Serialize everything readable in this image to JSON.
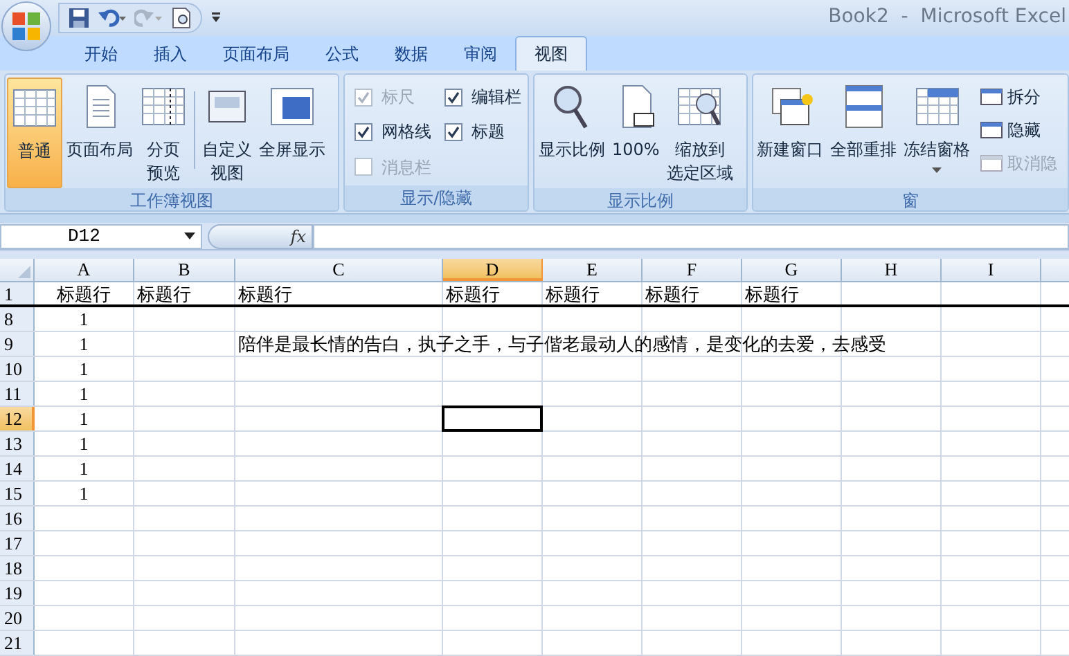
{
  "window": {
    "title": "Book2  -  Microsoft Excel"
  },
  "tabs": [
    {
      "label": "开始",
      "selected": false
    },
    {
      "label": "插入",
      "selected": false
    },
    {
      "label": "页面布局",
      "selected": false
    },
    {
      "label": "公式",
      "selected": false
    },
    {
      "label": "数据",
      "selected": false
    },
    {
      "label": "审阅",
      "selected": false
    },
    {
      "label": "视图",
      "selected": true
    }
  ],
  "ribbon": [
    {
      "label": "工作簿视图",
      "items": [
        {
          "kind": "large",
          "label": "普通",
          "selected": true
        },
        {
          "kind": "large",
          "label": "页面布局",
          "selected": false
        },
        {
          "kind": "large",
          "lines": [
            "分页",
            "预览"
          ],
          "selected": false
        },
        {
          "kind": "separator"
        },
        {
          "kind": "large",
          "lines": [
            "自定义",
            "视图"
          ],
          "selected": false
        },
        {
          "kind": "large",
          "label": "全屏显示",
          "selected": false
        }
      ]
    },
    {
      "label": "显示/隐藏",
      "items": [
        {
          "kind": "check",
          "label": "标尺",
          "checked": true,
          "disabled": true
        },
        {
          "kind": "check",
          "label": "网格线",
          "checked": true,
          "disabled": false
        },
        {
          "kind": "check",
          "label": "消息栏",
          "checked": false,
          "disabled": true
        },
        {
          "kind": "check",
          "label": "编辑栏",
          "checked": true,
          "disabled": false
        },
        {
          "kind": "check",
          "label": "标题",
          "checked": true,
          "disabled": false
        }
      ]
    },
    {
      "label": "显示比例",
      "items": [
        {
          "kind": "large",
          "label": "显示比例",
          "selected": false
        },
        {
          "kind": "large",
          "label": "100%",
          "selected": false
        },
        {
          "kind": "large",
          "lines": [
            "缩放到",
            "选定区域"
          ],
          "selected": false
        }
      ]
    },
    {
      "label": "窗",
      "items": [
        {
          "kind": "large",
          "label": "新建窗口",
          "selected": false
        },
        {
          "kind": "large",
          "label": "全部重排",
          "selected": false
        },
        {
          "kind": "large",
          "label": "冻结窗格",
          "selected": false,
          "dropdown": true
        },
        {
          "kind": "small",
          "label": "拆分",
          "disabled": false
        },
        {
          "kind": "small",
          "label": "隐藏",
          "disabled": false
        },
        {
          "kind": "small",
          "label": "取消隐",
          "disabled": true
        }
      ]
    }
  ],
  "name_box": {
    "value": "D12"
  },
  "formula_bar": {
    "fx": "fx"
  },
  "columns": [
    {
      "label": "A",
      "selected": false
    },
    {
      "label": "B",
      "selected": false
    },
    {
      "label": "C",
      "selected": false
    },
    {
      "label": "D",
      "selected": true
    },
    {
      "label": "E",
      "selected": false
    },
    {
      "label": "F",
      "selected": false
    },
    {
      "label": "G",
      "selected": false
    },
    {
      "label": "H",
      "selected": false
    },
    {
      "label": "I",
      "selected": false
    }
  ],
  "rows": [
    {
      "number": "1",
      "selected": false,
      "cells": [
        "标题行",
        "标题行",
        "标题行",
        "标题行",
        "标题行",
        "标题行",
        "标题行",
        null,
        null
      ]
    },
    {
      "number": "8",
      "selected": false,
      "cells": [
        "1",
        null,
        null,
        null,
        null,
        null,
        null,
        null,
        null
      ]
    },
    {
      "number": "9",
      "selected": false,
      "cells": [
        "1",
        null,
        "陪伴是最长情的告白，执子之手，与子偕老最动人的感情，是变化的去爱，去感受",
        null,
        null,
        null,
        null,
        null,
        null
      ]
    },
    {
      "number": "10",
      "selected": false,
      "cells": [
        "1",
        null,
        null,
        null,
        null,
        null,
        null,
        null,
        null
      ]
    },
    {
      "number": "11",
      "selected": false,
      "cells": [
        "1",
        null,
        null,
        null,
        null,
        null,
        null,
        null,
        null
      ]
    },
    {
      "number": "12",
      "selected": true,
      "cells": [
        "1",
        null,
        null,
        {
          "active": true
        },
        null,
        null,
        null,
        null,
        null
      ]
    },
    {
      "number": "13",
      "selected": false,
      "cells": [
        "1",
        null,
        null,
        null,
        null,
        null,
        null,
        null,
        null
      ]
    },
    {
      "number": "14",
      "selected": false,
      "cells": [
        "1",
        null,
        null,
        null,
        null,
        null,
        null,
        null,
        null
      ]
    },
    {
      "number": "15",
      "selected": false,
      "cells": [
        "1",
        null,
        null,
        null,
        null,
        null,
        null,
        null,
        null
      ]
    },
    {
      "number": "16",
      "selected": false,
      "cells": [
        null,
        null,
        null,
        null,
        null,
        null,
        null,
        null,
        null
      ]
    },
    {
      "number": "17",
      "selected": false,
      "cells": [
        null,
        null,
        null,
        null,
        null,
        null,
        null,
        null,
        null
      ]
    },
    {
      "number": "18",
      "selected": false,
      "cells": [
        null,
        null,
        null,
        null,
        null,
        null,
        null,
        null,
        null
      ]
    },
    {
      "number": "19",
      "selected": false,
      "cells": [
        null,
        null,
        null,
        null,
        null,
        null,
        null,
        null,
        null
      ]
    },
    {
      "number": "20",
      "selected": false,
      "cells": [
        null,
        null,
        null,
        null,
        null,
        null,
        null,
        null,
        null
      ]
    },
    {
      "number": "21",
      "selected": false,
      "cells": [
        null,
        null,
        null,
        null,
        null,
        null,
        null,
        null,
        null
      ]
    }
  ]
}
